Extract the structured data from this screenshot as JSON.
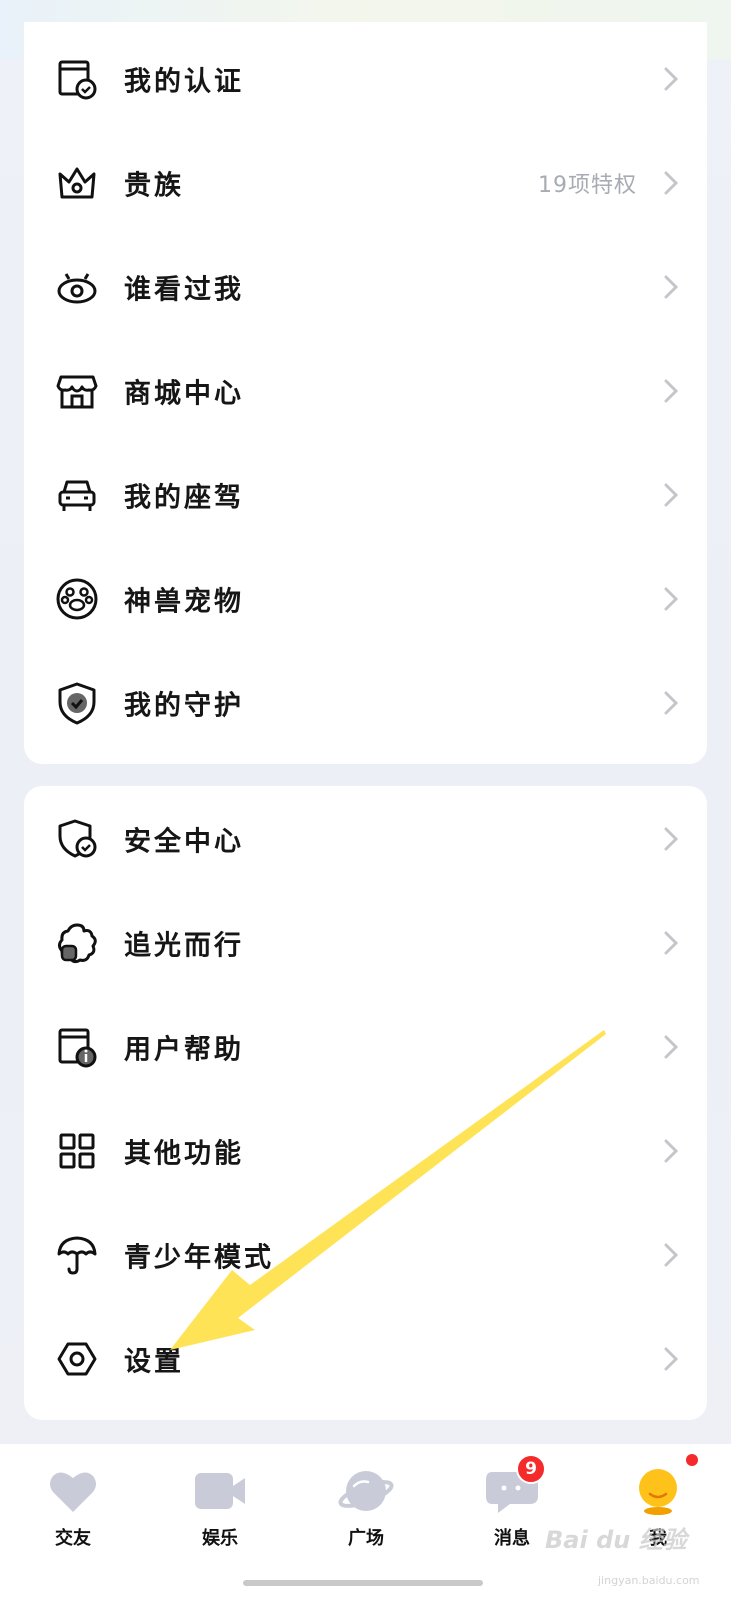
{
  "menu_group_1": [
    {
      "label": "我的认证",
      "icon": "certificate-icon",
      "extra": ""
    },
    {
      "label": "贵族",
      "icon": "crown-icon",
      "extra": "19项特权"
    },
    {
      "label": "谁看过我",
      "icon": "eye-icon",
      "extra": ""
    },
    {
      "label": "商城中心",
      "icon": "store-icon",
      "extra": ""
    },
    {
      "label": "我的座驾",
      "icon": "car-icon",
      "extra": ""
    },
    {
      "label": "神兽宠物",
      "icon": "paw-icon",
      "extra": ""
    },
    {
      "label": "我的守护",
      "icon": "shield-check-icon",
      "extra": ""
    }
  ],
  "menu_group_2": [
    {
      "label": "安全中心",
      "icon": "security-shield-icon",
      "extra": ""
    },
    {
      "label": "追光而行",
      "icon": "flower-icon",
      "extra": ""
    },
    {
      "label": "用户帮助",
      "icon": "help-doc-icon",
      "extra": ""
    },
    {
      "label": "其他功能",
      "icon": "grid-icon",
      "extra": ""
    },
    {
      "label": "青少年模式",
      "icon": "umbrella-icon",
      "extra": ""
    },
    {
      "label": "设置",
      "icon": "settings-hex-icon",
      "extra": ""
    }
  ],
  "tabbar": {
    "tabs": [
      {
        "label": "交友",
        "icon": "heart-icon"
      },
      {
        "label": "娱乐",
        "icon": "video-camera-icon"
      },
      {
        "label": "广场",
        "icon": "planet-icon"
      },
      {
        "label": "消息",
        "icon": "chat-bubble-icon",
        "badge": "9"
      },
      {
        "label": "我",
        "icon": "avatar-icon",
        "dot": true
      }
    ]
  },
  "watermark": {
    "brand": "Bai du 经验",
    "url": "jingyan.baidu.com"
  },
  "colors": {
    "arrow": "#ffe14d",
    "badge": "#f52a2a",
    "avatar": "#ffc21a"
  }
}
